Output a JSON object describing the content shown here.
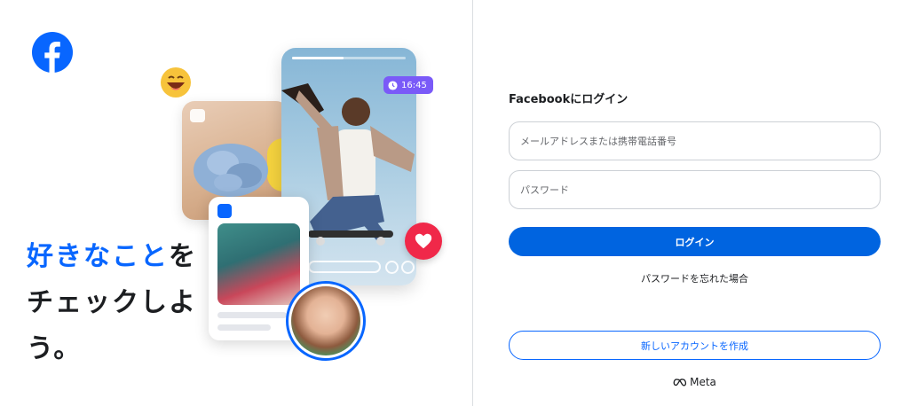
{
  "brand": {
    "logo_icon": "facebook-logo-icon",
    "accent_color": "#0866ff"
  },
  "hero": {
    "tagline_line1_accent": "好きなこと",
    "tagline_line1_rest": "を",
    "tagline_line2": "チェックしよ",
    "tagline_line3": "う。",
    "time_badge": "16:45",
    "video_progress": 0.45
  },
  "login": {
    "title": "Facebookにログイン",
    "email_placeholder": "メールアドレスまたは携帯電話番号",
    "password_placeholder": "パスワード",
    "login_button": "ログイン",
    "forgot_password": "パスワードを忘れた場合",
    "create_account": "新しいアカウントを作成",
    "button_color": "#0064e0"
  },
  "footer": {
    "meta_label": "Meta",
    "meta_icon": "meta-infinity-icon"
  }
}
